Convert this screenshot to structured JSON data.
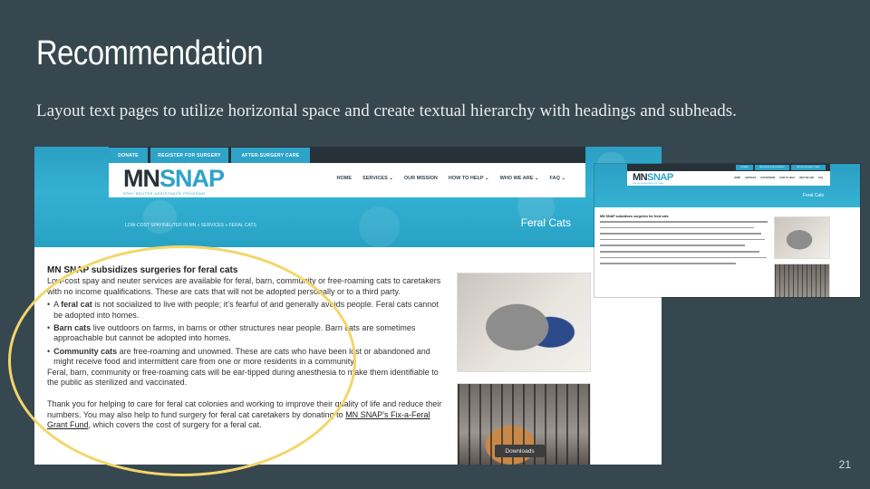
{
  "slide": {
    "title": "Recommendation",
    "subtitle": "Layout text pages to utilize horizontal space and create textual hierarchy with headings and subheads.",
    "page_number": "21"
  },
  "main_screenshot": {
    "top_buttons": [
      "DONATE",
      "REGISTER FOR SURGERY",
      "AFTER-SURGERY CARE"
    ],
    "logo": {
      "mn": "MN",
      "snap": "SNAP",
      "tagline": "SPAY NEUTER ASSISTANCE PROGRAM"
    },
    "nav": [
      "HOME",
      "SERVICES ⌄",
      "OUR MISSION",
      "HOW TO HELP ⌄",
      "WHO WE ARE ⌄",
      "FAQ ⌄"
    ],
    "breadcrumb": "LOW-COST SPAY/NEUTER IN MN » SERVICES » FERAL CATS",
    "hero_title": "Feral Cats",
    "content": {
      "heading": "MN SNAP subsidizes surgeries for feral cats",
      "intro": "Low-cost spay and neuter services are available for feral, barn, community or free-roaming cats to caretakers with no income qualifications. These are cats that will not be adopted personally or to a third party.",
      "bullets": [
        {
          "bold": "feral cat",
          "prefix": "A ",
          "text": " is not socialized to live with people; it’s fearful of and generally avoids people. Feral cats cannot be adopted into homes."
        },
        {
          "bold": "Barn cats",
          "prefix": "",
          "text": " live outdoors on farms, in barns or other structures near people. Barn cats are sometimes approachable but cannot be adopted into homes."
        },
        {
          "bold": "Community cats",
          "prefix": "",
          "text": " are free-roaming and unowned. These are cats who have been lost or abandoned and might receive food and intermittent care from one or more residents in a community."
        }
      ],
      "ear_tip": "Feral, barn, community or free-roaming cats will be ear-tipped during anesthesia to make them identifiable to the public as sterilized and vaccinated.",
      "thanks_start": "Thank you for helping to care for feral cat colonies and working to improve their quality of life and reduce their numbers. You may also help to fund surgery for feral cat caretakers by donating to ",
      "thanks_link": "MN SNAP’s Fix-a-Feral Grant Fund",
      "thanks_end": ", which covers the cost of surgery for a feral cat."
    },
    "download_label": "Downloads"
  },
  "small_screenshot": {
    "top_buttons": [
      "DONATE",
      "REGISTER FOR SURGERY",
      "AFTER-SURGERY CARE"
    ],
    "logo": {
      "mn": "MN",
      "snap": "SNAP",
      "tagline": "SPAY NEUTER ASSISTANCE PROGRAM"
    },
    "nav": [
      "HOME",
      "SERVICES",
      "OUR MISSION",
      "HOW TO HELP",
      "WHO WE ARE",
      "FAQ"
    ],
    "hero_title": "Feral Cats",
    "heading": "MN SNAP subsidizes surgeries for feral cats"
  },
  "colors": {
    "background": "#37474f",
    "brand": "#2ea3c8",
    "highlight": "#f3d66a"
  }
}
